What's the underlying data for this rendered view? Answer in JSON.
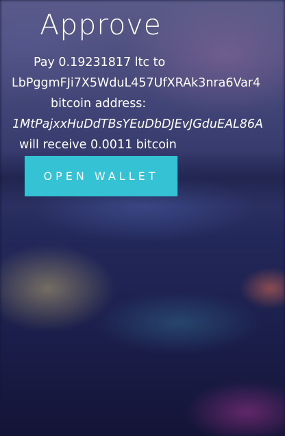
{
  "header": {
    "title": "Approve"
  },
  "payment": {
    "pay_line": "Pay 0.19231817 ltc to",
    "ltc_address": "LbPggmFJi7X5WduL457UfXRAk3nra6Var4",
    "bitcoin_address_label": "bitcoin address:",
    "btc_address": "1MtPajxxHuDdTBsYEuDbDJEvJGduEAL86A",
    "receive_line": "will receive 0.0011 bitcoin"
  },
  "actions": {
    "open_wallet_label": "OPEN WALLET"
  },
  "colors": {
    "button": "#35c2d5",
    "text": "#ffffff"
  }
}
